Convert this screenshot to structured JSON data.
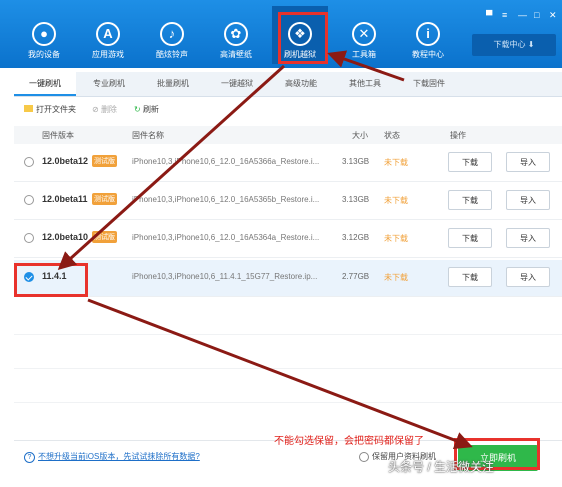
{
  "nav": {
    "items": [
      {
        "label": "我的设备",
        "icon": "apple-icon"
      },
      {
        "label": "应用游戏",
        "icon": "appstore-icon"
      },
      {
        "label": "酷炫铃声",
        "icon": "bell-icon"
      },
      {
        "label": "高清壁纸",
        "icon": "flower-icon"
      },
      {
        "label": "刷机越狱",
        "icon": "dropbox-icon"
      },
      {
        "label": "工具箱",
        "icon": "tools-icon"
      },
      {
        "label": "教程中心",
        "icon": "info-icon"
      }
    ],
    "download_center": "下载中心"
  },
  "tabs": [
    "一键刷机",
    "专业刷机",
    "批量刷机",
    "一键越狱",
    "高级功能",
    "其他工具",
    "下载固件"
  ],
  "toolbar": {
    "open_folder": "打开文件夹",
    "delete": "删除",
    "refresh": "刷新"
  },
  "table": {
    "headers": {
      "version": "固件版本",
      "name": "固件名称",
      "size": "大小",
      "status": "状态",
      "action": "操作"
    },
    "rows": [
      {
        "version": "12.0beta12",
        "badge": "测试版",
        "name": "iPhone10,3,iPhone10,6_12.0_16A5366a_Restore.i...",
        "size": "3.13GB",
        "status": "未下载",
        "download": "下载",
        "import": "导入",
        "selected": false
      },
      {
        "version": "12.0beta11",
        "badge": "测试版",
        "name": "iPhone10,3,iPhone10,6_12.0_16A5365b_Restore.i...",
        "size": "3.13GB",
        "status": "未下载",
        "download": "下载",
        "import": "导入",
        "selected": false
      },
      {
        "version": "12.0beta10",
        "badge": "测试版",
        "name": "iPhone10,3,iPhone10,6_12.0_16A5364a_Restore.i...",
        "size": "3.12GB",
        "status": "未下载",
        "download": "下载",
        "import": "导入",
        "selected": false
      },
      {
        "version": "11.4.1",
        "badge": "",
        "name": "iPhone10,3,iPhone10,6_11.4.1_15G77_Restore.ip...",
        "size": "2.77GB",
        "status": "未下载",
        "download": "下载",
        "import": "导入",
        "selected": true
      }
    ]
  },
  "bottom": {
    "help_link": "不想升级当前iOS版本，先试试抹除所有数据?",
    "keep_data": "保留用户资料刷机",
    "flash_button": "立即刷机"
  },
  "annotation": "不能勾选保留，会把密码都保留了",
  "watermark": "头条号 / 生活微关注",
  "colors": {
    "brand": "#0b72cc",
    "beta_badge": "#f1a13a",
    "flash_button": "#2fb84a",
    "annotation_red": "#e8322c"
  }
}
